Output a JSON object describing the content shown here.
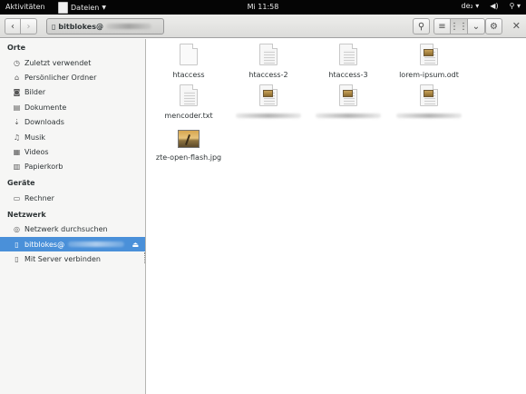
{
  "topbar": {
    "activities": "Aktivitäten",
    "app_menu": "Dateien",
    "clock": "Mi 11:58",
    "keyboard": "de₂"
  },
  "header": {
    "path_label": "bitblokes@"
  },
  "sidebar": {
    "sections": [
      {
        "title": "Orte",
        "items": [
          {
            "label": "Zuletzt verwendet",
            "icon": "clock-icon"
          },
          {
            "label": "Persönlicher Ordner",
            "icon": "home-icon"
          },
          {
            "label": "Bilder",
            "icon": "camera-icon"
          },
          {
            "label": "Dokumente",
            "icon": "document-icon"
          },
          {
            "label": "Downloads",
            "icon": "download-icon"
          },
          {
            "label": "Musik",
            "icon": "music-icon"
          },
          {
            "label": "Videos",
            "icon": "film-icon"
          },
          {
            "label": "Papierkorb",
            "icon": "trash-icon"
          }
        ]
      },
      {
        "title": "Geräte",
        "items": [
          {
            "label": "Rechner",
            "icon": "drive-icon"
          }
        ]
      },
      {
        "title": "Netzwerk",
        "items": [
          {
            "label": "Netzwerk durchsuchen",
            "icon": "network-icon"
          },
          {
            "label": "bitblokes@",
            "icon": "network-server-icon",
            "selected": true
          },
          {
            "label": "Mit Server verbinden",
            "icon": "connect-server-icon"
          }
        ]
      }
    ]
  },
  "files": [
    {
      "name": "htaccess",
      "icon": "text-file-icon"
    },
    {
      "name": "htaccess-2",
      "icon": "text-file-icon"
    },
    {
      "name": "htaccess-3",
      "icon": "text-file-icon"
    },
    {
      "name": "lorem-ipsum.odt",
      "icon": "odt-file-icon"
    },
    {
      "name": "mencoder.txt",
      "icon": "text-file-icon"
    },
    {
      "name": "",
      "icon": "image-doc-icon",
      "obscured": true
    },
    {
      "name": "",
      "icon": "image-doc-icon",
      "obscured": true
    },
    {
      "name": "",
      "icon": "image-doc-icon",
      "obscured": true
    },
    {
      "name": "zte-open-flash.jpg",
      "icon": "image-file-icon"
    }
  ]
}
